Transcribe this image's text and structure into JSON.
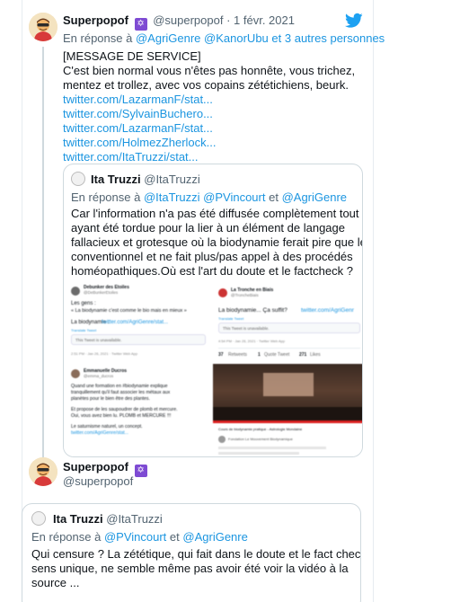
{
  "tweet1": {
    "author_name": "Superpopof",
    "author_badge": "🕎",
    "author_handle": "@superpopof",
    "separator": "·",
    "date": "1 févr. 2021",
    "reply_prefix": "En réponse à",
    "reply_to_1": "@AgriGenre",
    "reply_to_2": "@KanorUbu",
    "reply_suffix": "et 3 autres personnes",
    "text_lines": [
      "[MESSAGE DE SERVICE]",
      "C'est bien normal vous n'êtes pas honnête, vous trichez,",
      "mentez et trollez, avec vos copains zététichiens, beurk."
    ],
    "links": [
      "twitter.com/LazarmanF/stat...",
      "twitter.com/SylvainBuchero...",
      "twitter.com/LazarmanF/stat...",
      "twitter.com/HolmezZherlock...",
      "twitter.com/ItaTruzzi/stat..."
    ],
    "quote": {
      "author_name": "Ita Truzzi",
      "author_handle": "@ItaTruzzi",
      "reply_prefix": "En réponse à",
      "reply_to_1": "@ItaTruzzi",
      "reply_to_2": "@PVincourt",
      "reply_join": "et",
      "reply_to_3": "@AgriGenre",
      "text_lines": [
        "Car l'information n'a pas été diffusée complètement tout",
        "ayant été tordue pour la lier à un élément de langage",
        "fallacieux et grotesque où la biodynamie ferait pire que le",
        "conventionnel et ne fait plus/pas appel à des procédés",
        "homéopathiques.Où est l'art du doute et le factcheck ?"
      ],
      "media": {
        "shot1": {
          "name": "Debunker des Etoiles",
          "handle": "@DeBunkerEtoiles",
          "line1": "Les gens :",
          "line2": "« La biodynamie c'est comme le bio mais en mieux »",
          "line3": "La biodynamie :",
          "link": "twitter.com/AgriGenre/stat...",
          "translate": "Translate Tweet",
          "unavail": "This Tweet is unavailable.",
          "meta": "2:51 PM · Jan 26, 2021 · Twitter Web App"
        },
        "shot2": {
          "name": "La Tronche en Biais",
          "handle": "@TroncheBiais",
          "line1": "La biodynamie... Ça suffit?",
          "link": "twitter.com/AgriGenr",
          "translate": "Translate Tweet",
          "unavail": "This Tweet is unavailable.",
          "meta": "4:54 PM · Jan 26, 2021 · Twitter Web App",
          "stat_retweets": "37",
          "stat_retweets_label": "Retweets",
          "stat_quotes": "1",
          "stat_quotes_label": "Quote Tweet",
          "stat_likes": "271",
          "stat_likes_label": "Likes"
        },
        "shot3": {
          "name": "Emmanuelle Ducros",
          "handle": "@emma_ducros",
          "lines": [
            "Quand une formation en #biodynamie explique",
            "tranquillement qu'il faut associer les métaux aux",
            "planètes pour le bien être des plantes.",
            "",
            "Et propose de les saupoudrer de plomb et mercure.",
            "Oui, vous avez bien lu. PLOMB et MERCURE !!!",
            "",
            "Le saturnisme naturel, un concept."
          ],
          "link": "twitter.com/AgriGenre/stat..."
        },
        "shot4": {
          "caption": "Cours de biodynamie pratique - Astrologie Mondaine",
          "channel": "Fondation Le Mouvement Biodynamique"
        }
      }
    }
  },
  "tweet2": {
    "author_name": "Superpopof",
    "author_badge": "🕎",
    "author_handle": "@superpopof",
    "quote": {
      "author_name": "Ita Truzzi",
      "author_handle": "@ItaTruzzi",
      "reply_prefix": "En réponse à",
      "reply_to_1": "@PVincourt",
      "reply_join": "et",
      "reply_to_2": "@AgriGenre",
      "text_lines": [
        "Qui censure ? La zététique, qui fait dans le doute et le fact check à",
        "sens unique, ne semble même pas avoir été voir la vidéo à la",
        "source ..."
      ]
    }
  },
  "colors": {
    "link": "#1b95e0",
    "muted": "#536471",
    "border": "#cfd9de",
    "twitter_blue": "#1da1f2"
  }
}
